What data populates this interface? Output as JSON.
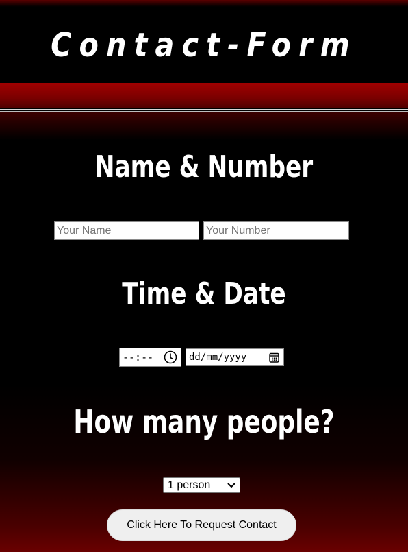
{
  "header": {
    "title": "Contact-Form"
  },
  "sections": {
    "name_number": {
      "heading": "Name & Number",
      "name_placeholder": "Your Name",
      "number_placeholder": "Your Number"
    },
    "time_date": {
      "heading": "Time & Date",
      "time_placeholder": "--:--",
      "date_placeholder": "dd/mm/yyyy"
    },
    "people": {
      "heading": "How many people?",
      "selected": "1 person"
    }
  },
  "submit": {
    "label": "Click Here To Request Contact"
  },
  "icons": {
    "time": "clock-icon",
    "date": "calendar-icon",
    "select": "chevron-down-icon"
  },
  "colors": {
    "accent": "#8b0000",
    "background": "#000000",
    "text": "#ffffff"
  }
}
